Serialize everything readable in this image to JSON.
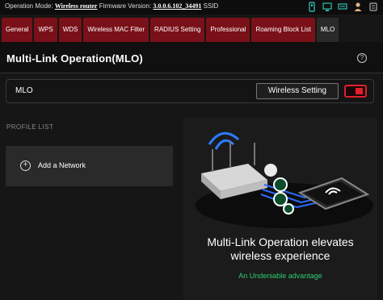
{
  "status_bar": {
    "operation_mode_label": "Operation Mode:",
    "operation_mode_value": "Wireless router",
    "firmware_label": "Firmware Version:",
    "firmware_value": "3.0.0.6.102_34491",
    "ssid_label": "SSID"
  },
  "tabs": [
    {
      "label": "General",
      "active": false
    },
    {
      "label": "WPS",
      "active": false
    },
    {
      "label": "WDS",
      "active": false
    },
    {
      "label": "Wireless MAC Filter",
      "active": false
    },
    {
      "label": "RADIUS Setting",
      "active": false
    },
    {
      "label": "Professional",
      "active": false
    },
    {
      "label": "Roaming Block List",
      "active": false
    },
    {
      "label": "MLO",
      "active": true
    }
  ],
  "page": {
    "title": "Multi-Link Operation(MLO)",
    "help_glyph": "?"
  },
  "mlo": {
    "label": "MLO",
    "wireless_setting_button": "Wireless Setting",
    "toggle_state": "on",
    "accent_color": "#e01f2d"
  },
  "profile_list": {
    "heading": "PROFILE LIST",
    "add_glyph": "+",
    "add_network_label": "Add a Network"
  },
  "promo": {
    "title_line1": "Multi-Link Operation elevates",
    "title_line2": "wireless experience",
    "subtitle": "An Undeniable advantage",
    "subtitle_color": "#2ecc71"
  }
}
